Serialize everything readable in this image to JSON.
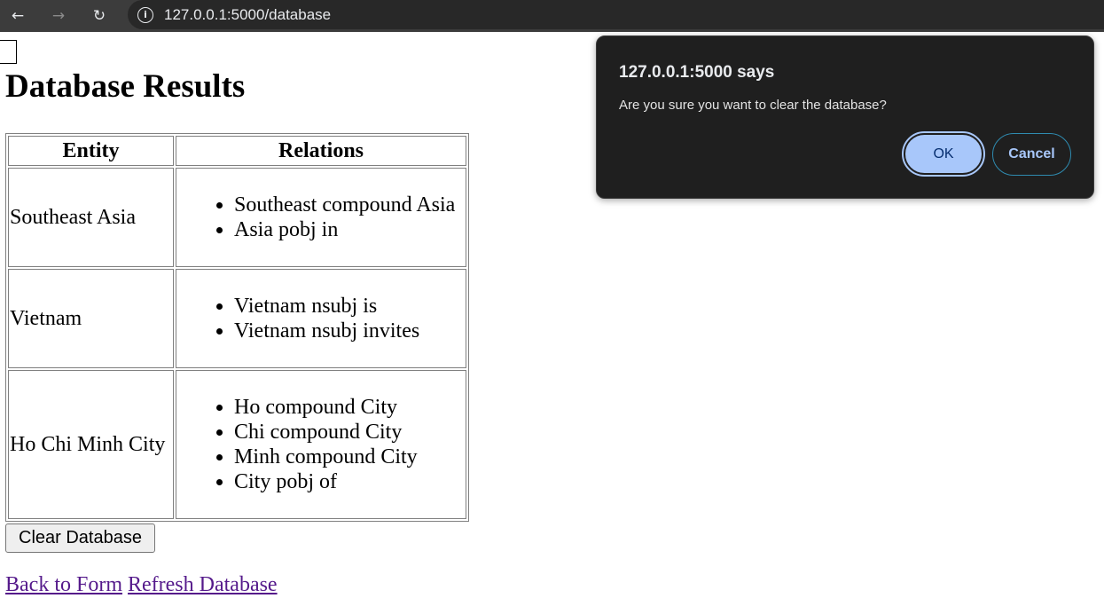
{
  "browser": {
    "url": "127.0.0.1:5000/database"
  },
  "page": {
    "title": "Database Results",
    "table": {
      "headers": [
        "Entity",
        "Relations"
      ],
      "rows": [
        {
          "entity": "Southeast Asia",
          "relations": [
            "Southeast compound Asia",
            "Asia pobj in"
          ]
        },
        {
          "entity": "Vietnam",
          "relations": [
            "Vietnam nsubj is",
            "Vietnam nsubj invites"
          ]
        },
        {
          "entity": "Ho Chi Minh City",
          "relations": [
            "Ho compound City",
            "Chi compound City",
            "Minh compound City",
            "City pobj of"
          ]
        }
      ]
    },
    "clear_button": "Clear Database",
    "links": {
      "back": "Back to Form",
      "refresh": "Refresh Database"
    }
  },
  "dialog": {
    "title": "127.0.0.1:5000 says",
    "message": "Are you sure you want to clear the database?",
    "ok_label": "OK",
    "cancel_label": "Cancel"
  }
}
